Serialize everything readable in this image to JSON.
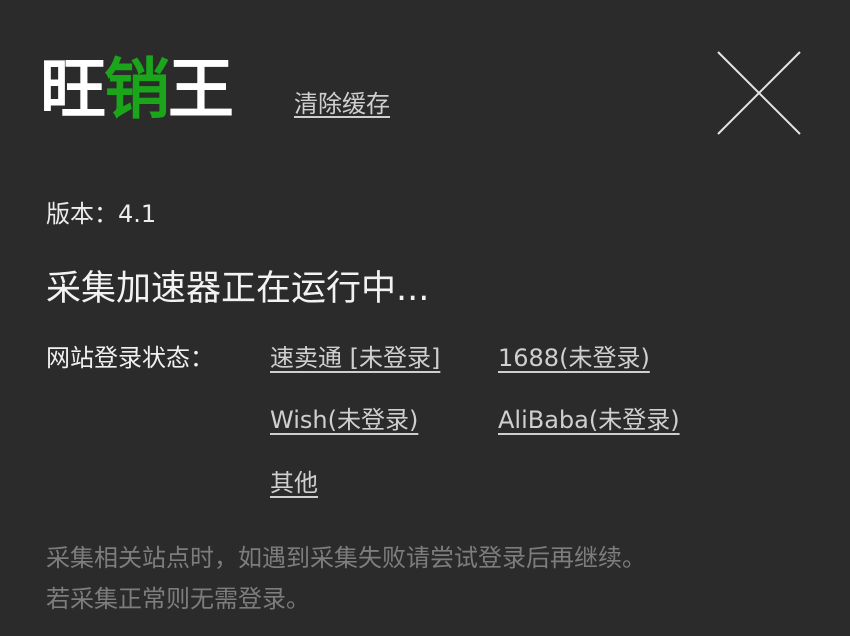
{
  "logo": {
    "part1": "旺",
    "part2": "销",
    "part3": "王"
  },
  "header": {
    "clear_cache_label": "清除缓存"
  },
  "close": {
    "icon": "close-icon"
  },
  "version": {
    "text": "版本：4.1"
  },
  "status": {
    "running_text": "采集加速器正在运行中..."
  },
  "login": {
    "label": "网站登录状态：",
    "sites": [
      {
        "text": "速卖通 [未登录]"
      },
      {
        "text": "1688(未登录) "
      },
      {
        "text": "Wish(未登录)"
      },
      {
        "text": "AliBaba(未登录) "
      },
      {
        "text": "其他"
      }
    ]
  },
  "notice": {
    "line1": "采集相关站点时，如遇到采集失败请尝试登录后再继续。",
    "line2": "若采集正常则无需登录。"
  },
  "colors": {
    "background": "#2b2b2b",
    "logo_accent": "#1aa51a",
    "link": "#cfcfcf",
    "muted": "#7d7d7d"
  }
}
